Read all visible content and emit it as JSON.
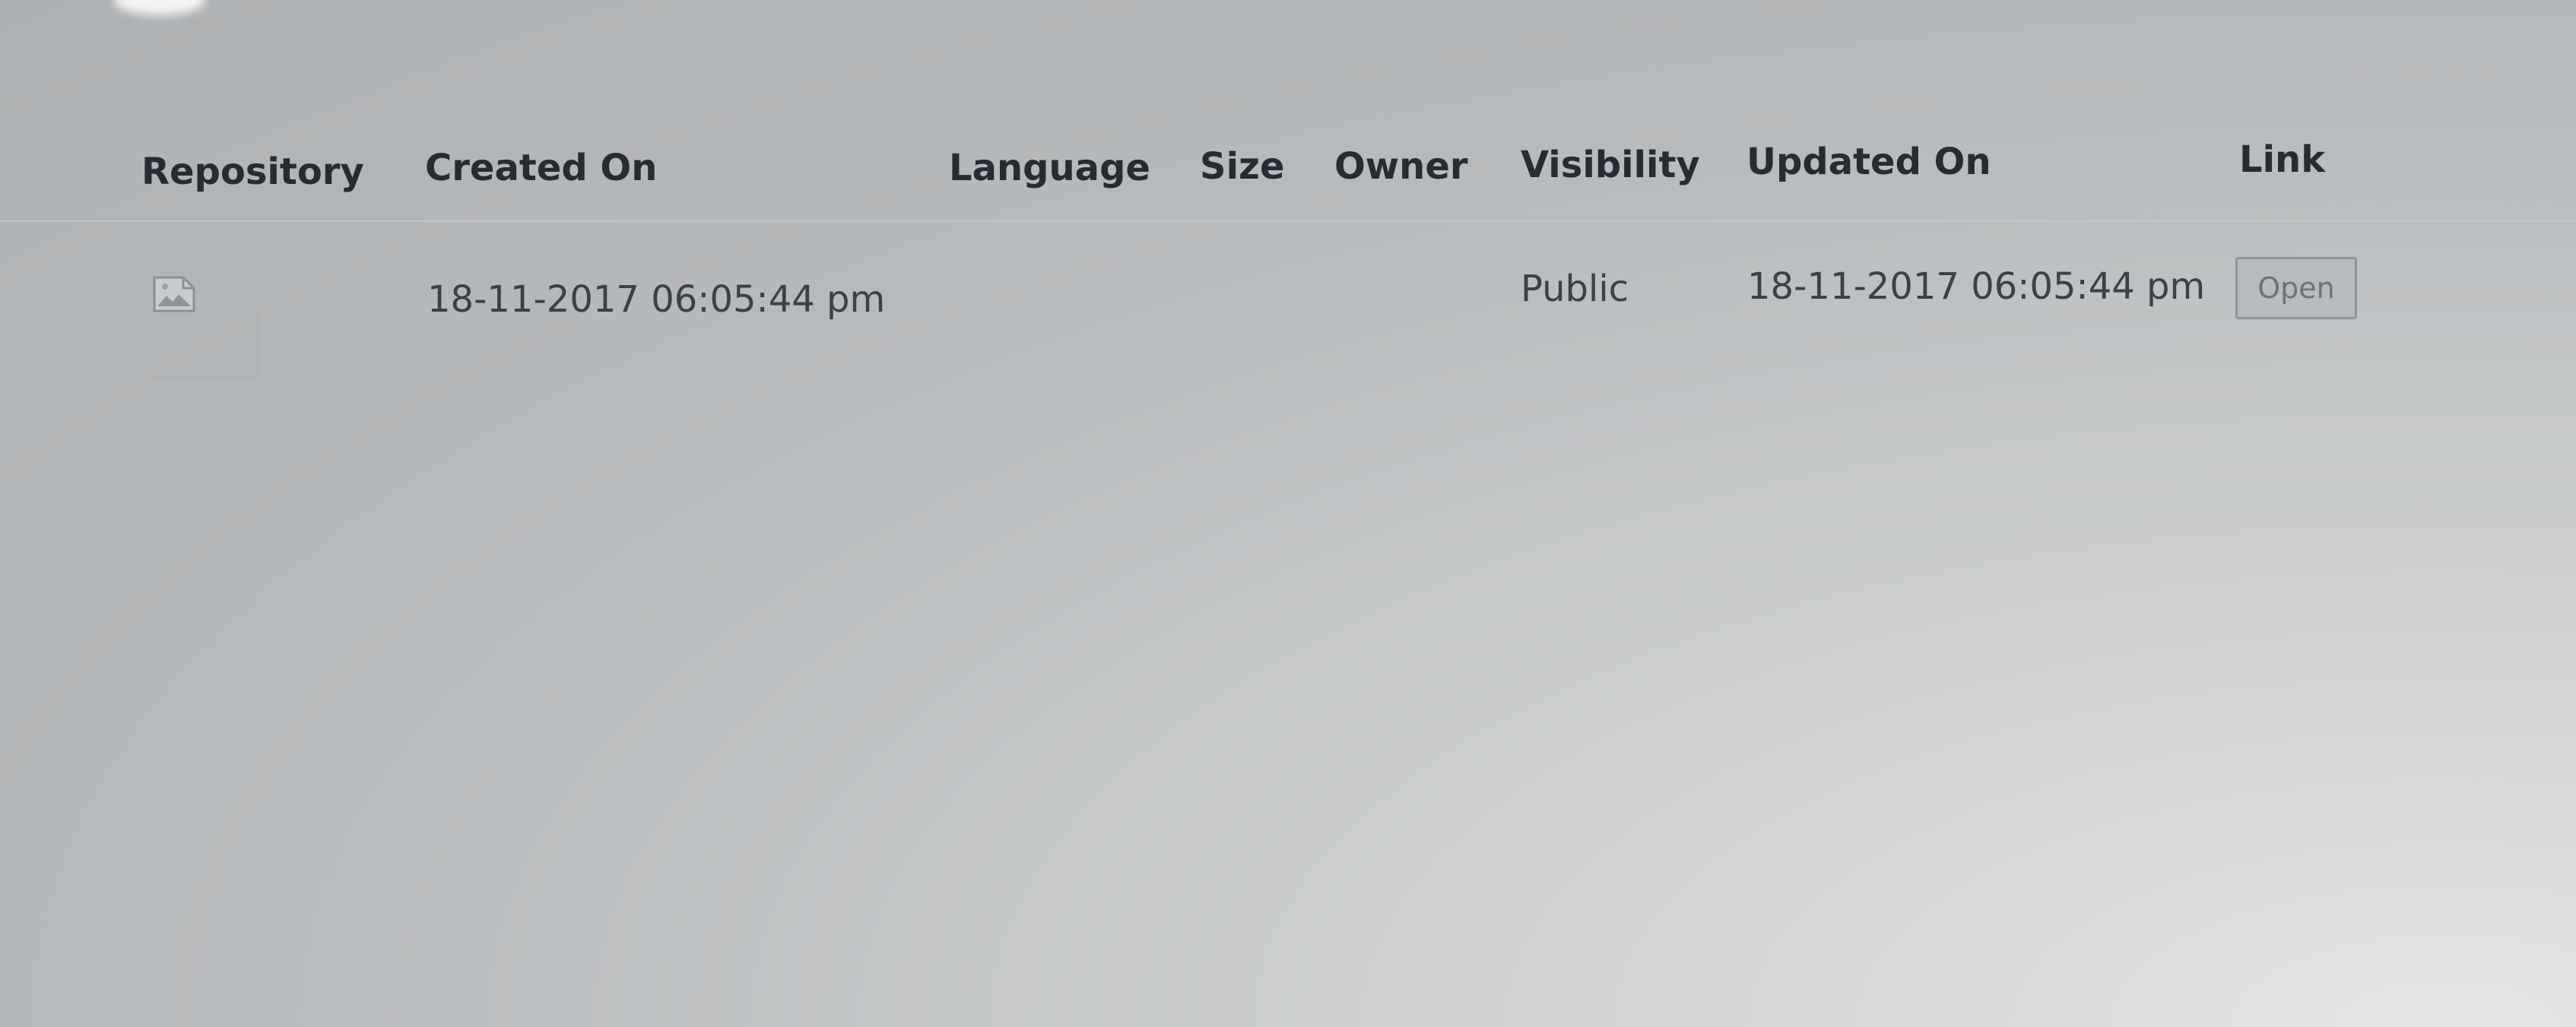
{
  "table": {
    "headers": [
      {
        "key": "repository",
        "label": "Repository"
      },
      {
        "key": "created_on",
        "label": "Created On"
      },
      {
        "key": "language",
        "label": "Language"
      },
      {
        "key": "size",
        "label": "Size"
      },
      {
        "key": "owner",
        "label": "Owner"
      },
      {
        "key": "visibility",
        "label": "Visibility"
      },
      {
        "key": "updated_on",
        "label": "Updated On"
      },
      {
        "key": "link",
        "label": "Link"
      }
    ],
    "rows": [
      {
        "repository_thumbnail": "broken-image-icon",
        "created_on": "18-11-2017 06:05:44 pm",
        "language": "",
        "size": "",
        "owner": "",
        "visibility": "Public",
        "updated_on": "18-11-2017 06:05:44 pm",
        "link_label": "Open"
      }
    ]
  }
}
